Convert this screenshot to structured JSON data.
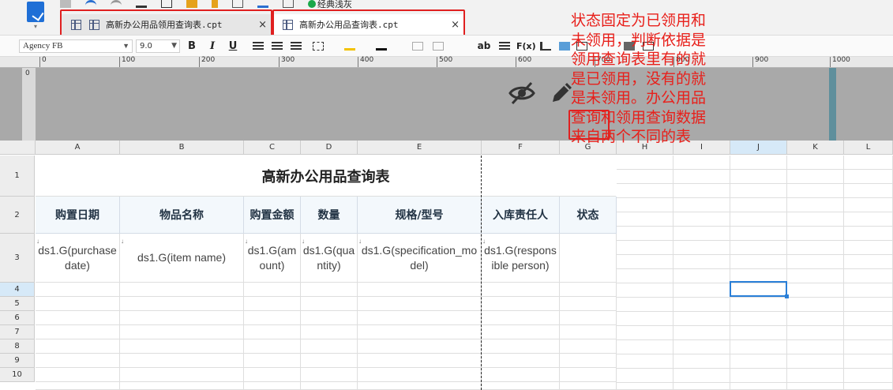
{
  "app": {
    "menu_caret": "▾"
  },
  "toolbar": {
    "theme_label": "经典浅灰"
  },
  "tabs": [
    {
      "label": "高新办公用品领用查询表.cpt",
      "close": "×"
    },
    {
      "label": "高新办公用品查询表.cpt",
      "close": "×"
    }
  ],
  "format": {
    "font": "Agency FB",
    "size": "9.0",
    "bold": "B",
    "italic": "I",
    "underline": "U",
    "text_dir": "ab",
    "formula": "F(x)"
  },
  "ruler": {
    "marks": [
      "0",
      "100",
      "200",
      "300",
      "400",
      "500",
      "600",
      "700",
      "800",
      "900",
      "1000"
    ]
  },
  "vruler": "0",
  "columns": [
    "A",
    "B",
    "C",
    "D",
    "E",
    "F",
    "G",
    "H",
    "I",
    "J",
    "K",
    "L"
  ],
  "rows": [
    "1",
    "2",
    "3",
    "4",
    "5",
    "6",
    "7",
    "8",
    "9",
    "10"
  ],
  "report": {
    "title": "高新办公用品查询表",
    "headers": [
      "购置日期",
      "物品名称",
      "购置金额",
      "数量",
      "规格/型号",
      "入库责任人",
      "状态"
    ],
    "bindings": [
      "ds1.G(purchase date)",
      "ds1.G(item name)",
      "ds1.G(amount)",
      "ds1.G(quantity)",
      "ds1.G(specification_model)",
      "ds1.G(responsible person)"
    ]
  },
  "annotation": "状态固定为已领用和未领用，判断依据是领用查询表里有的就是已领用，没有的就是未领用。办公用品查询和领用查询数据来自两个不同的表",
  "colors": {
    "annotation": "#e8201b",
    "selection": "#2a7fd8",
    "header_fill": "#f3f8fc"
  }
}
